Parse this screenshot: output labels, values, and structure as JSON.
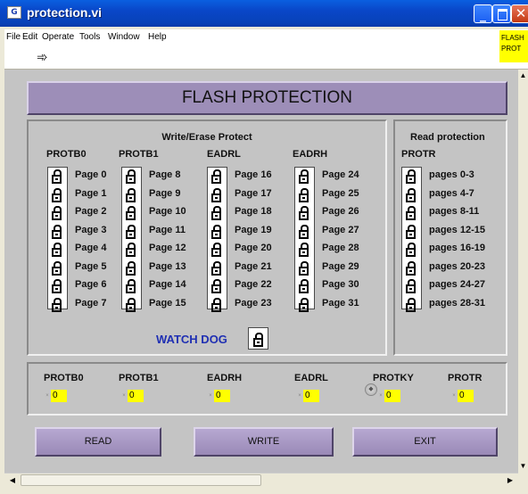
{
  "window": {
    "title": "protection.vi",
    "app_icon_text": "G"
  },
  "menu": [
    "File",
    "Edit",
    "Operate",
    "Tools",
    "Window",
    "Help"
  ],
  "note_text": "FLASH PROT",
  "panel": {
    "title": "FLASH PROTECTION",
    "write_erase_title": "Write/Erase Protect",
    "read_protection_title": "Read protection",
    "columns": [
      {
        "label": "PROTB0",
        "pages": [
          "Page 0",
          "Page 1",
          "Page 2",
          "Page 3",
          "Page 4",
          "Page 5",
          "Page 6",
          "Page 7"
        ]
      },
      {
        "label": "PROTB1",
        "pages": [
          "Page 8",
          "Page 9",
          "Page 10",
          "Page 11",
          "Page 12",
          "Page 13",
          "Page 14",
          "Page 15"
        ]
      },
      {
        "label": "EADRL",
        "pages": [
          "Page 16",
          "Page 17",
          "Page 18",
          "Page 19",
          "Page 20",
          "Page 21",
          "Page 22",
          "Page 23"
        ]
      },
      {
        "label": "EADRH",
        "pages": [
          "Page 24",
          "Page 25",
          "Page 26",
          "Page 27",
          "Page 28",
          "Page 29",
          "Page 30",
          "Page 31"
        ]
      },
      {
        "label": "PROTR",
        "pages": [
          "pages 0-3",
          "pages 4-7",
          "pages 8-11",
          "pages 12-15",
          "pages 16-19",
          "pages 20-23",
          "pages 24-27",
          "pages 28-31"
        ]
      }
    ],
    "watchdog_label": "WATCH DOG",
    "indicators": [
      {
        "label": "PROTB0",
        "value": "0"
      },
      {
        "label": "PROTB1",
        "value": "0"
      },
      {
        "label": "EADRH",
        "value": "0"
      },
      {
        "label": "EADRL",
        "value": "0"
      },
      {
        "label": "PROTKY",
        "value": "0"
      },
      {
        "label": "PROTR",
        "value": "0"
      }
    ],
    "buttons": {
      "read": "READ",
      "write": "WRITE",
      "exit": "EXIT"
    }
  }
}
